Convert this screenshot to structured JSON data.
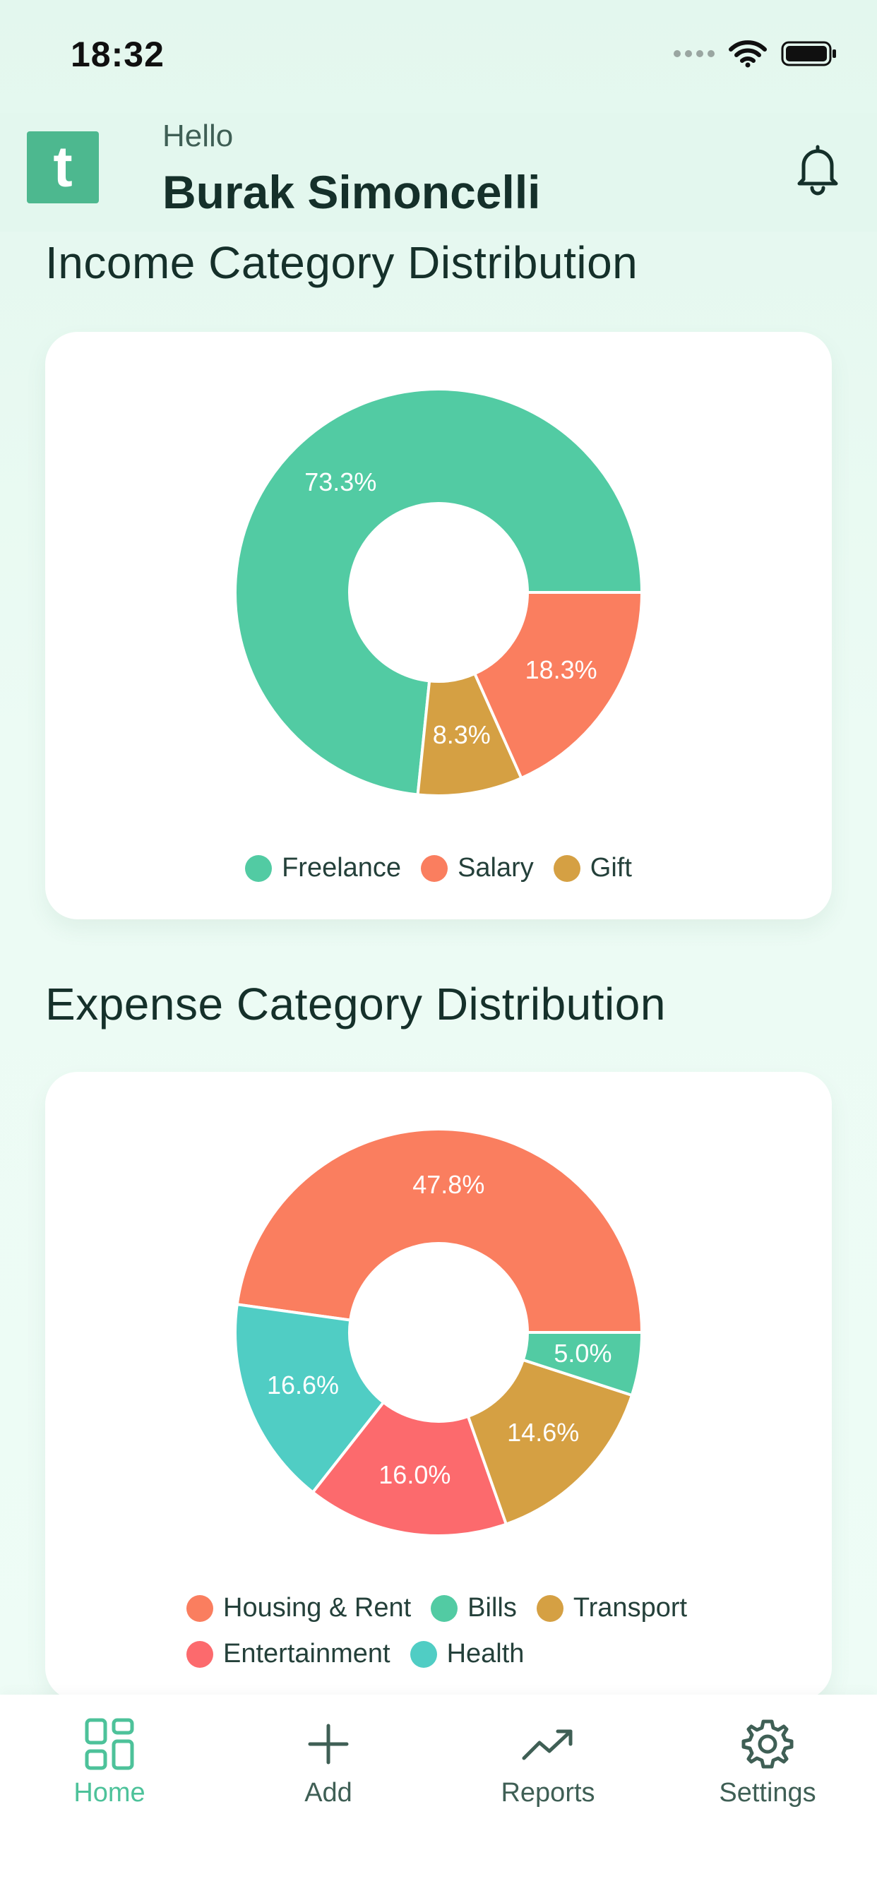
{
  "status_bar": {
    "time": "18:32"
  },
  "header": {
    "logo_letter": "t",
    "greeting": "Hello",
    "user_name": "Burak Simoncelli",
    "icons": [
      "bell-icon"
    ]
  },
  "income_section": {
    "title": "Income Category Distribution"
  },
  "expense_section": {
    "title": "Expense Category Distribution"
  },
  "chart_data": [
    {
      "type": "pie",
      "title": "Income Category Distribution",
      "donut": true,
      "start_angle": "3 o'clock, counter-clockwise",
      "legend_placement": "bottom-center",
      "slices": [
        {
          "name": "Freelance",
          "value": 73.3,
          "label": "73.3%",
          "color": "#52cba3"
        },
        {
          "name": "Gift",
          "value": 8.3,
          "label": "8.3%",
          "color": "#d5a043"
        },
        {
          "name": "Salary",
          "value": 18.3,
          "label": "18.3%",
          "color": "#fa7e5f"
        }
      ],
      "legend": [
        {
          "name": "Freelance",
          "color": "#52cba3"
        },
        {
          "name": "Salary",
          "color": "#fa7e5f"
        },
        {
          "name": "Gift",
          "color": "#d5a043"
        }
      ]
    },
    {
      "type": "pie",
      "title": "Expense Category Distribution",
      "donut": true,
      "start_angle": "3 o'clock, counter-clockwise",
      "legend_placement": "bottom-center",
      "slices": [
        {
          "name": "Housing & Rent",
          "value": 47.8,
          "label": "47.8%",
          "color": "#fa7e5f"
        },
        {
          "name": "Health",
          "value": 16.6,
          "label": "16.6%",
          "color": "#50cdc4"
        },
        {
          "name": "Entertainment",
          "value": 16.0,
          "label": "16.0%",
          "color": "#fc6a6d"
        },
        {
          "name": "Transport",
          "value": 14.6,
          "label": "14.6%",
          "color": "#d5a043"
        },
        {
          "name": "Bills",
          "value": 5.0,
          "label": "5.0%",
          "color": "#52cba3"
        }
      ],
      "legend": [
        {
          "name": "Housing & Rent",
          "color": "#fa7e5f"
        },
        {
          "name": "Bills",
          "color": "#52cba3"
        },
        {
          "name": "Transport",
          "color": "#d5a043"
        },
        {
          "name": "Entertainment",
          "color": "#fc6a6d"
        },
        {
          "name": "Health",
          "color": "#50cdc4"
        }
      ]
    }
  ],
  "bottom_nav": {
    "items": [
      {
        "label": "Home",
        "icon": "grid-icon",
        "active": true
      },
      {
        "label": "Add",
        "icon": "plus-icon",
        "active": false
      },
      {
        "label": "Reports",
        "icon": "trend-up-icon",
        "active": false
      },
      {
        "label": "Settings",
        "icon": "gear-icon",
        "active": false
      }
    ]
  },
  "colors": {
    "accent": "#4dc29a",
    "logo_bg": "#4db88f",
    "header_bg": "#e3f7ee",
    "text_dark": "#15302a"
  }
}
